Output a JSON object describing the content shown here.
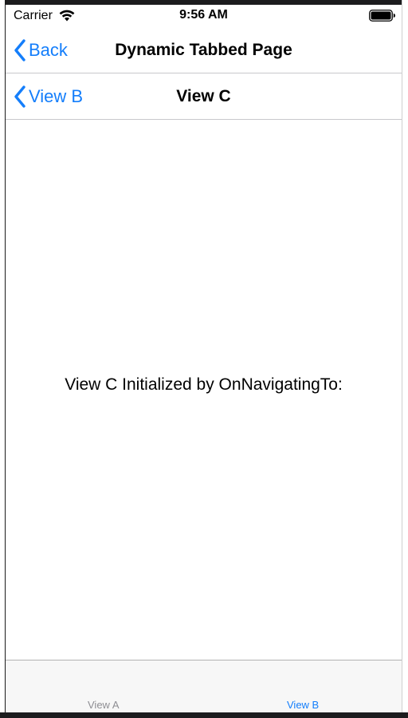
{
  "status_bar": {
    "carrier": "Carrier",
    "time": "9:56 AM"
  },
  "primary_nav": {
    "back_label": "Back",
    "title": "Dynamic Tabbed Page"
  },
  "secondary_nav": {
    "back_label": "View B",
    "title": "View C"
  },
  "content": {
    "message": "View C Initialized by OnNavigatingTo:"
  },
  "tab_bar": {
    "tabs": [
      {
        "label": "View A",
        "selected": false
      },
      {
        "label": "View B",
        "selected": true
      }
    ]
  },
  "colors": {
    "accent": "#147efb",
    "inactive_tab": "#8e8e93",
    "tab_bar_background": "#f7f7f7"
  }
}
